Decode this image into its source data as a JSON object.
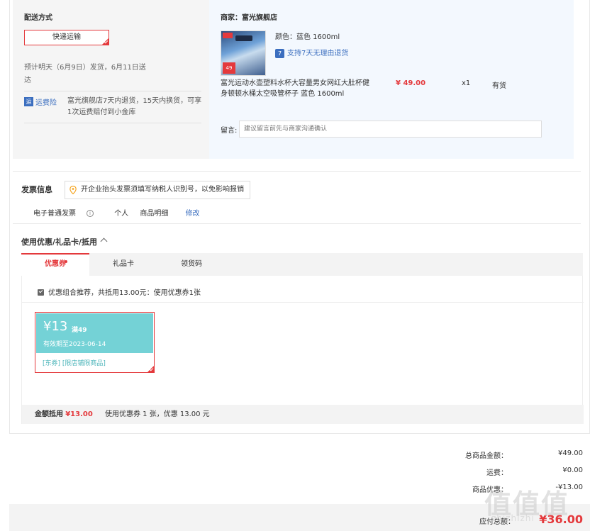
{
  "shipping": {
    "label": "配送方式",
    "method": "快递运输",
    "date_text": "预计明天（6月9日）发货，6月11日送达",
    "insurance_icon": "运",
    "insurance_name": "运费险",
    "insurance_desc": "富光旗舰店7天内退货，15天内换货，可享1次运费赔付到小金库"
  },
  "order": {
    "shop_label": "商家：富光旗舰店",
    "product_attr": "颜色：蓝色 1600ml",
    "return_icon": "7",
    "return_text": "支持7天无理由退货",
    "product_title": "富光运动水壶塑料水杯大容量男女网红大肚杯健身顿顿水桶太空吸管杯子 蓝色 1600ml",
    "price": "¥ 49.00",
    "qty": "x1",
    "stock": "有货",
    "image_price": "49",
    "remark_label": "留言:",
    "remark_placeholder": "建议留言前先与商家沟通确认"
  },
  "invoice": {
    "title": "发票信息",
    "tip": "开企业抬头发票须填写纳税人识别号，以免影响报销",
    "type": "电子普通发票",
    "info_glyph": "i",
    "holder": "个人",
    "content": "商品明细",
    "edit": "修改"
  },
  "coupons": {
    "title": "使用优惠/礼品卡/抵用",
    "tabs": [
      "优惠券",
      "礼品卡",
      "领货码"
    ],
    "combo_text": "优惠组合推荐，共抵用13.00元：使用优惠券1张",
    "card": {
      "amount": "¥13",
      "condition": "满49",
      "valid": "有效期至2023-06-14",
      "scope": "[东券]  [限店铺限商品]"
    },
    "foot_label": "金额抵用",
    "foot_amount": "¥13.00",
    "foot_desc": "使用优惠券 1 张，优惠 13.00 元"
  },
  "totals": {
    "goods_label": "总商品金额：",
    "goods_value": "¥49.00",
    "freight_label": "运费：",
    "freight_value": "¥0.00",
    "discount_label": "商品优惠：",
    "discount_value": "-¥13.00",
    "pay_label": "应付总额：",
    "pay_value": "¥36.00"
  },
  "watermark": {
    "mark": "值值值",
    "site": "zhizhizhi"
  },
  "colors": {
    "accent": "#e4393c",
    "link": "#3b6ebf",
    "coupon": "#74d2d6"
  }
}
